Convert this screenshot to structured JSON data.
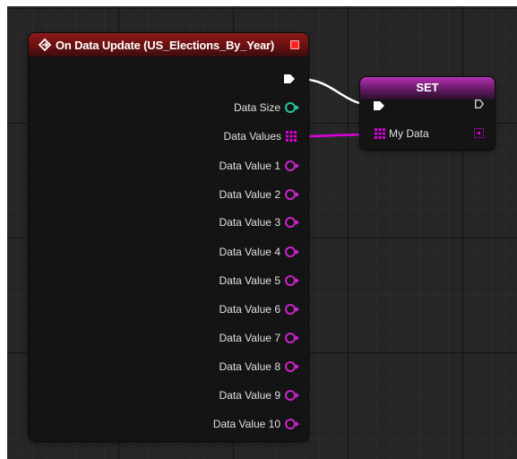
{
  "event_node": {
    "title": "On Data Update (US_Elections_By_Year)",
    "icon": "event-diamond-icon",
    "delegate_pin_color": "#ff2424",
    "pins": [
      {
        "label": "Data Size",
        "type": "int",
        "color": "#1fc8a0"
      },
      {
        "label": "Data Values",
        "type": "array",
        "color": "#e000e0"
      },
      {
        "label": "Data Value 1",
        "type": "object",
        "color": "#cc22cc"
      },
      {
        "label": "Data Value 2",
        "type": "object",
        "color": "#cc22cc"
      },
      {
        "label": "Data Value 3",
        "type": "object",
        "color": "#cc22cc"
      },
      {
        "label": "Data Value 4",
        "type": "object",
        "color": "#cc22cc"
      },
      {
        "label": "Data Value 5",
        "type": "object",
        "color": "#cc22cc"
      },
      {
        "label": "Data Value 6",
        "type": "object",
        "color": "#cc22cc"
      },
      {
        "label": "Data Value 7",
        "type": "object",
        "color": "#cc22cc"
      },
      {
        "label": "Data Value 8",
        "type": "object",
        "color": "#cc22cc"
      },
      {
        "label": "Data Value 9",
        "type": "object",
        "color": "#cc22cc"
      },
      {
        "label": "Data Value 10",
        "type": "object",
        "color": "#cc22cc"
      }
    ]
  },
  "set_node": {
    "title": "SET",
    "variable_label": "My Data",
    "header_color": "#b430b4"
  },
  "wire_colors": {
    "exec": "#ffffff",
    "array": "#e000e0"
  }
}
